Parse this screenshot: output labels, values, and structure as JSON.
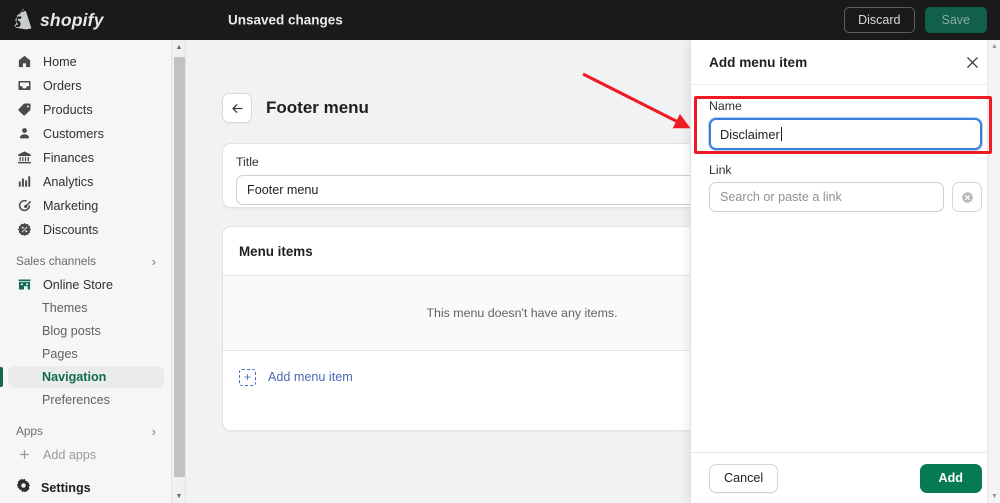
{
  "topbar": {
    "brand": "shopify",
    "brand_icon": "shopify-bag-icon",
    "status_text": "Unsaved changes",
    "discard_label": "Discard",
    "save_label": "Save",
    "bg_color": "#1a1a1a",
    "save_color": "#11614a"
  },
  "sidebar": {
    "primary_items": [
      {
        "label": "Home",
        "icon": "home-icon"
      },
      {
        "label": "Orders",
        "icon": "orders-inbox-icon"
      },
      {
        "label": "Products",
        "icon": "products-tag-icon"
      },
      {
        "label": "Customers",
        "icon": "customers-person-icon"
      },
      {
        "label": "Finances",
        "icon": "finances-bank-icon"
      },
      {
        "label": "Analytics",
        "icon": "analytics-bars-icon"
      },
      {
        "label": "Marketing",
        "icon": "marketing-megaphone-icon"
      },
      {
        "label": "Discounts",
        "icon": "discounts-badge-icon"
      }
    ],
    "sales_channels_label": "Sales channels",
    "sales_channels_chevron": "chevron-right-icon",
    "online_store": {
      "label": "Online Store",
      "icon": "storefront-icon"
    },
    "online_store_children": [
      {
        "label": "Themes",
        "active": false
      },
      {
        "label": "Blog posts",
        "active": false
      },
      {
        "label": "Pages",
        "active": false
      },
      {
        "label": "Navigation",
        "active": true
      },
      {
        "label": "Preferences",
        "active": false
      }
    ],
    "apps_label": "Apps",
    "apps_chevron": "chevron-right-icon",
    "add_apps_label": "Add apps",
    "add_apps_icon": "plus-icon",
    "settings_label": "Settings",
    "settings_icon": "gear-icon",
    "active_color": "#0e6b52",
    "scrollbar": {
      "up_icon": "scroll-up-arrow",
      "down_icon": "scroll-down-arrow"
    }
  },
  "main": {
    "back_icon": "arrow-left-icon",
    "page_title": "Footer menu",
    "title_card": {
      "label": "Title",
      "value": "Footer menu"
    },
    "items_card": {
      "heading": "Menu items",
      "empty_text": "This menu doesn't have any items.",
      "add_label": "Add menu item",
      "add_icon": "plus-square-dashed-icon",
      "add_color": "#4a68b0"
    }
  },
  "drawer": {
    "title": "Add menu item",
    "close_icon": "close-icon",
    "name_field": {
      "label": "Name",
      "value": "Disclaimer",
      "focused": true
    },
    "link_field": {
      "label": "Link",
      "value": "",
      "placeholder": "Search or paste a link",
      "clear_icon": "clear-circle-x-icon"
    },
    "cancel_label": "Cancel",
    "add_label": "Add",
    "add_color": "#067a54",
    "scrollbar": {
      "up_icon": "scroll-up-arrow",
      "down_icon": "scroll-down-arrow"
    }
  },
  "annotations": {
    "highlight_color": "#ed1c24",
    "rect_target": "name-field",
    "arrow_target": "name-field"
  }
}
